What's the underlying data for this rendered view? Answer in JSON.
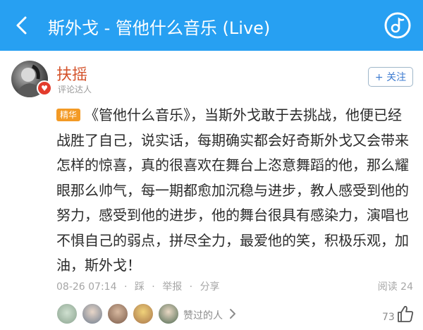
{
  "header": {
    "title": "斯外戈 - 管他什么音乐 (Live)",
    "back_icon": "back-arrow-icon",
    "right_icon": "music-disc-icon",
    "background": "#27a0f2"
  },
  "comment": {
    "username": "扶摇",
    "user_role": "评论达人",
    "avatar_badge_icon": "heart-badge-icon",
    "follow_label": "+ 关注",
    "tag": "精华",
    "text": "《管他什么音乐》，当斯外戈敢于去挑战，他便已经战胜了自己，说实话，每期确实都会好奇斯外戈又会带来怎样的惊喜，真的很喜欢在舞台上恣意舞蹈的他，那么耀眼那么帅气，每一期都愈加沉稳与进步，教人感受到他的努力，感受到他的进步，他的舞台很具有感染力，演唱也不惧自己的弱点，拼尽全力，最爱他的笑，积极乐观，加油，斯外戈！",
    "timestamp": "08-26 07:14",
    "separator": "·",
    "actions": [
      "踩",
      "举报",
      "分享"
    ],
    "reads": "阅读 24",
    "liked_by_label": "赞过的人",
    "like_count": "73",
    "accent_color": "#d4532b",
    "tag_color": "#f39a25"
  }
}
